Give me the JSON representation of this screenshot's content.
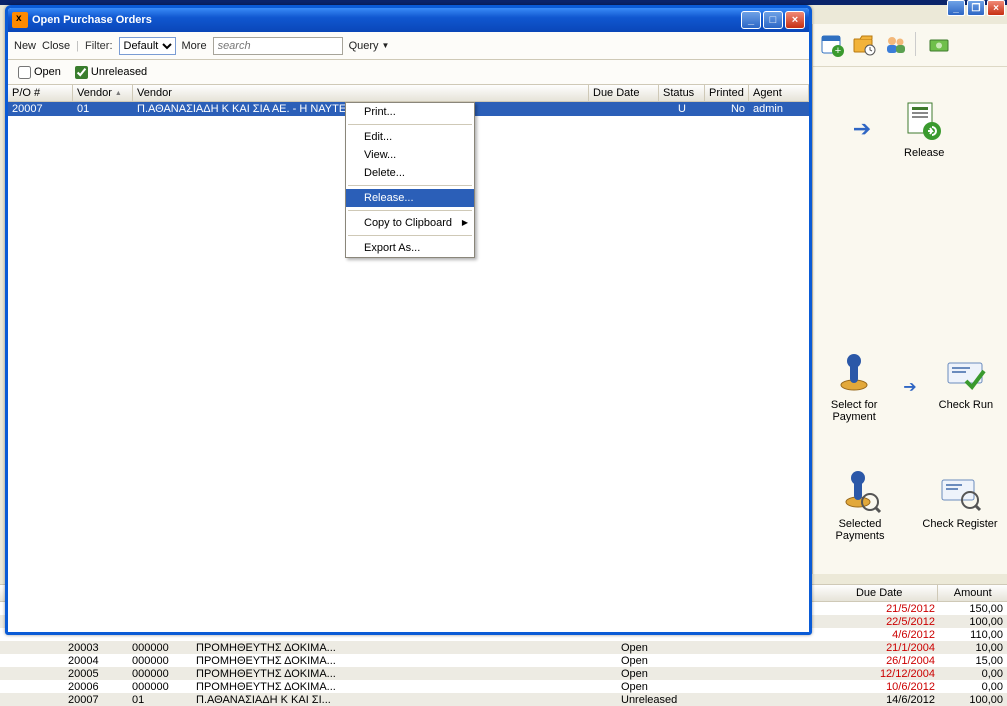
{
  "window": {
    "title": "Open Purchase Orders"
  },
  "toolbar": {
    "new": "New",
    "close": "Close",
    "filter_label": "Filter:",
    "filter_value": "Default",
    "more": "More",
    "search_placeholder": "search",
    "query": "Query"
  },
  "filters": {
    "open": "Open",
    "open_checked": false,
    "unreleased": "Unreleased",
    "unreleased_checked": true
  },
  "grid": {
    "headers": {
      "po": "P/O #",
      "vendor_short": "Vendor",
      "vendor_long": "Vendor",
      "due": "Due Date",
      "status": "Status",
      "printed": "Printed",
      "agent": "Agent"
    },
    "row": {
      "po": "20007",
      "vendor_short": "01",
      "vendor_long": "Π.ΑΘΑΝΑΣΙΑΔΗ Κ ΚΑΙ ΣΙΑ ΑΕ. - Η ΝΑΥΤΕ",
      "status": "U",
      "printed": "No",
      "agent": "admin"
    }
  },
  "context_menu": {
    "print": "Print...",
    "edit": "Edit...",
    "view": "View...",
    "del": "Delete...",
    "release": "Release...",
    "copy": "Copy to Clipboard",
    "export": "Export As..."
  },
  "right": {
    "release": "Release",
    "select_for_payment": "Select for Payment",
    "check_run": "Check Run",
    "selected_payments": "Selected Payments",
    "check_register": "Check Register"
  },
  "bg_header": {
    "due": "Due Date",
    "amount": "Amount"
  },
  "bg_rows": [
    {
      "due": "21/5/2012",
      "amount": "150,00",
      "cls": "red",
      "alt": false
    },
    {
      "due": "22/5/2012",
      "amount": "100,00",
      "cls": "red",
      "alt": true
    },
    {
      "due": "4/6/2012",
      "amount": "110,00",
      "cls": "red",
      "alt": false
    },
    {
      "po": "20003",
      "v1": "000000",
      "v2": "ΠΡΟΜΗΘΕΥΤΗΣ ΔΟΚΙΜΑ...",
      "st": "Open",
      "due": "21/1/2004",
      "amount": "10,00",
      "cls": "red",
      "alt": true
    },
    {
      "po": "20004",
      "v1": "000000",
      "v2": "ΠΡΟΜΗΘΕΥΤΗΣ ΔΟΚΙΜΑ...",
      "st": "Open",
      "due": "26/1/2004",
      "amount": "15,00",
      "cls": "red",
      "alt": false
    },
    {
      "po": "20005",
      "v1": "000000",
      "v2": "ΠΡΟΜΗΘΕΥΤΗΣ ΔΟΚΙΜΑ...",
      "st": "Open",
      "due": "12/12/2004",
      "amount": "0,00",
      "cls": "red",
      "alt": true
    },
    {
      "po": "20006",
      "v1": "000000",
      "v2": "ΠΡΟΜΗΘΕΥΤΗΣ ΔΟΚΙΜΑ...",
      "st": "Open",
      "due": "10/6/2012",
      "amount": "0,00",
      "cls": "red",
      "alt": false
    },
    {
      "po": "20007",
      "v1": "01",
      "v2": "Π.ΑΘΑΝΑΣΙΑΔΗ Κ ΚΑΙ ΣΙ...",
      "st": "Unreleased",
      "due": "14/6/2012",
      "amount": "100,00",
      "cls": "blk",
      "alt": true
    }
  ]
}
